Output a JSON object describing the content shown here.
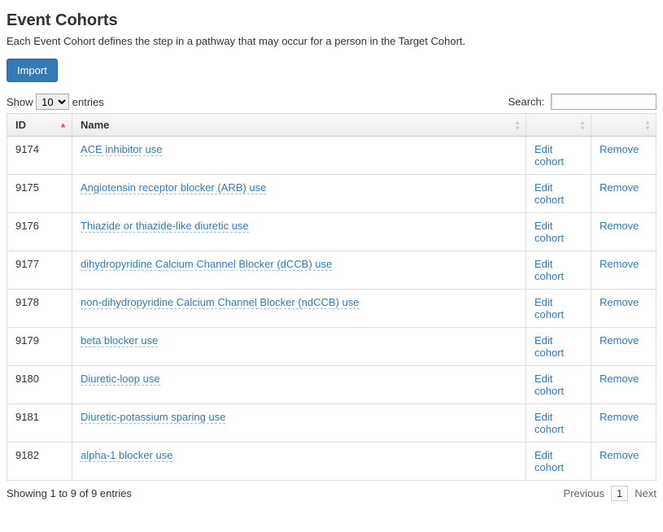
{
  "header": {
    "title": "Event Cohorts",
    "description": "Each Event Cohort defines the step in a pathway that may occur for a person in the Target Cohort.",
    "import_label": "Import"
  },
  "length": {
    "prefix": "Show",
    "value": "10",
    "suffix": "entries"
  },
  "search": {
    "label": "Search:",
    "value": ""
  },
  "columns": {
    "id": "ID",
    "name": "Name",
    "edit": "",
    "remove": ""
  },
  "actions": {
    "edit": "Edit cohort",
    "remove": "Remove"
  },
  "rows": [
    {
      "id": "9174",
      "name": "ACE inhibitor use"
    },
    {
      "id": "9175",
      "name": "Angiotensin receptor blocker (ARB) use"
    },
    {
      "id": "9176",
      "name": "Thiazide or thiazide-like diuretic use"
    },
    {
      "id": "9177",
      "name": "dihydropyridine Calcium Channel Blocker (dCCB) use"
    },
    {
      "id": "9178",
      "name": "non-dihydropyridine Calcium Channel Blocker (ndCCB) use"
    },
    {
      "id": "9179",
      "name": "beta blocker use"
    },
    {
      "id": "9180",
      "name": "Diuretic-loop use"
    },
    {
      "id": "9181",
      "name": "Diuretic-potassium sparing use"
    },
    {
      "id": "9182",
      "name": "alpha-1 blocker use"
    }
  ],
  "footer": {
    "info": "Showing 1 to 9 of 9 entries",
    "prev": "Previous",
    "page": "1",
    "next": "Next"
  }
}
